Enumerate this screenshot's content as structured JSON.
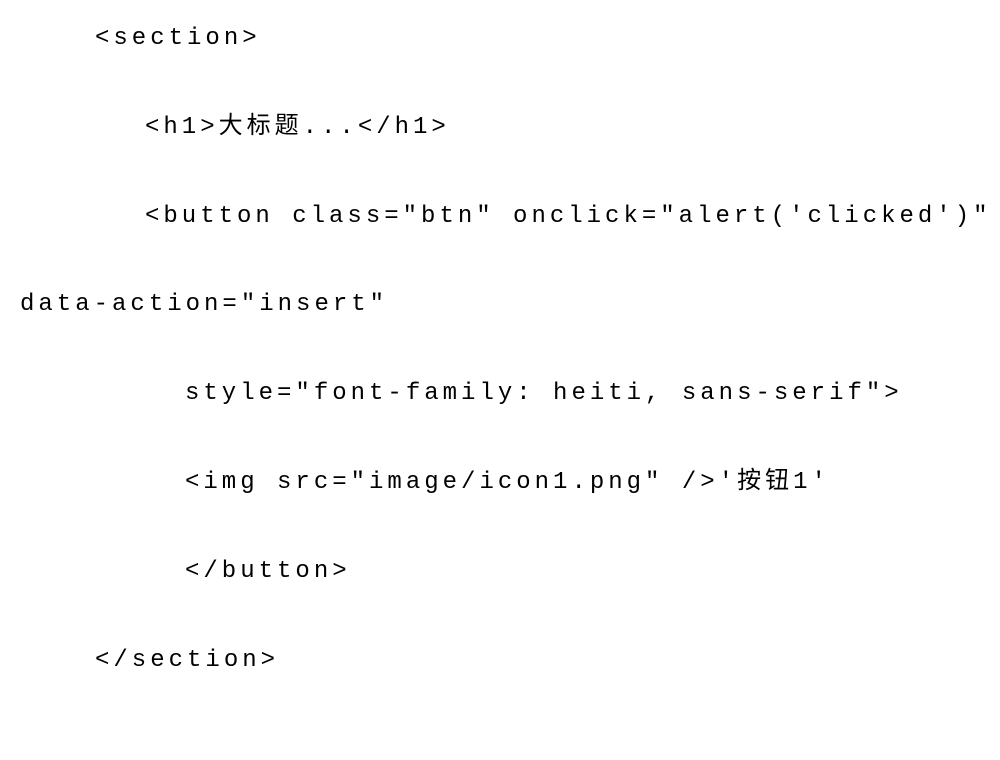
{
  "code": {
    "line1": "<section>",
    "line2": "<h1>大标题...</h1>",
    "line3": "<button class=\"btn\" onclick=\"alert('clicked')\"",
    "line4": "data-action=\"insert\"",
    "line5": "style=\"font-family: heiti, sans-serif\">",
    "line6": "<img src=\"image/icon1.png\" />'按钮1'",
    "line7": "</button>",
    "line8": "</section>"
  }
}
